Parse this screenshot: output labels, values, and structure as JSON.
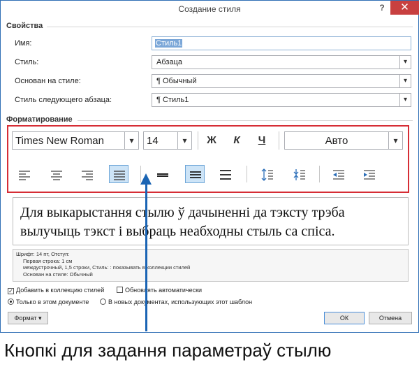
{
  "window": {
    "title": "Создание стиля",
    "help": "?",
    "close": "✕"
  },
  "properties": {
    "section_title": "Свойства",
    "name": {
      "label": "Имя:",
      "value": "Стиль1"
    },
    "style": {
      "label": "Стиль:",
      "value": "Абзаца"
    },
    "based_on": {
      "label": "Основан на стиле:",
      "value": "¶ Обычный"
    },
    "next_style": {
      "label": "Стиль следующего абзаца:",
      "value": "¶ Стиль1"
    }
  },
  "formatting": {
    "section_title": "Форматирование",
    "font": "Times New Roman",
    "size": "14",
    "bold": "Ж",
    "italic": "К",
    "underline": "Ч",
    "color": "Авто",
    "buttons": [
      "align-left-icon",
      "align-center-icon",
      "align-right-icon",
      "align-justify-icon",
      "single-spacing-icon",
      "one-half-spacing-icon",
      "double-spacing-icon",
      "increase-paragraph-spacing-icon",
      "decrease-paragraph-spacing-icon",
      "decrease-indent-icon",
      "increase-indent-icon"
    ]
  },
  "preview": {
    "text": "Для выкарыстання стылю ў дачыненні да тэксту трэба вылучыць тэкст і выбраць неабходны стыль са спіса."
  },
  "description": {
    "line1": "Шрифт: 14 пт, Отступ:",
    "line2": "Первая строка:  1 см",
    "line3": "междустрочный,  1,5 строки, Стиль: : показывать в коллекции стилей",
    "line4": "Основан на стиле: Обычный"
  },
  "options": {
    "add_to_gallery": "Добавить в коллекцию стилей",
    "auto_update": "Обновлять автоматически",
    "this_document": "Только в этом документе",
    "new_documents": "В новых документах, использующих этот шаблон"
  },
  "buttons": {
    "format": "Формат ▾",
    "ok": "ОК",
    "cancel": "Отмена"
  },
  "caption": "Кнопкі для задання параметраў стылю",
  "colors": {
    "accent": "#2f6fb5",
    "highlight_frame": "#d62d35",
    "pointer": "#1a64b4",
    "close": "#c84040"
  }
}
